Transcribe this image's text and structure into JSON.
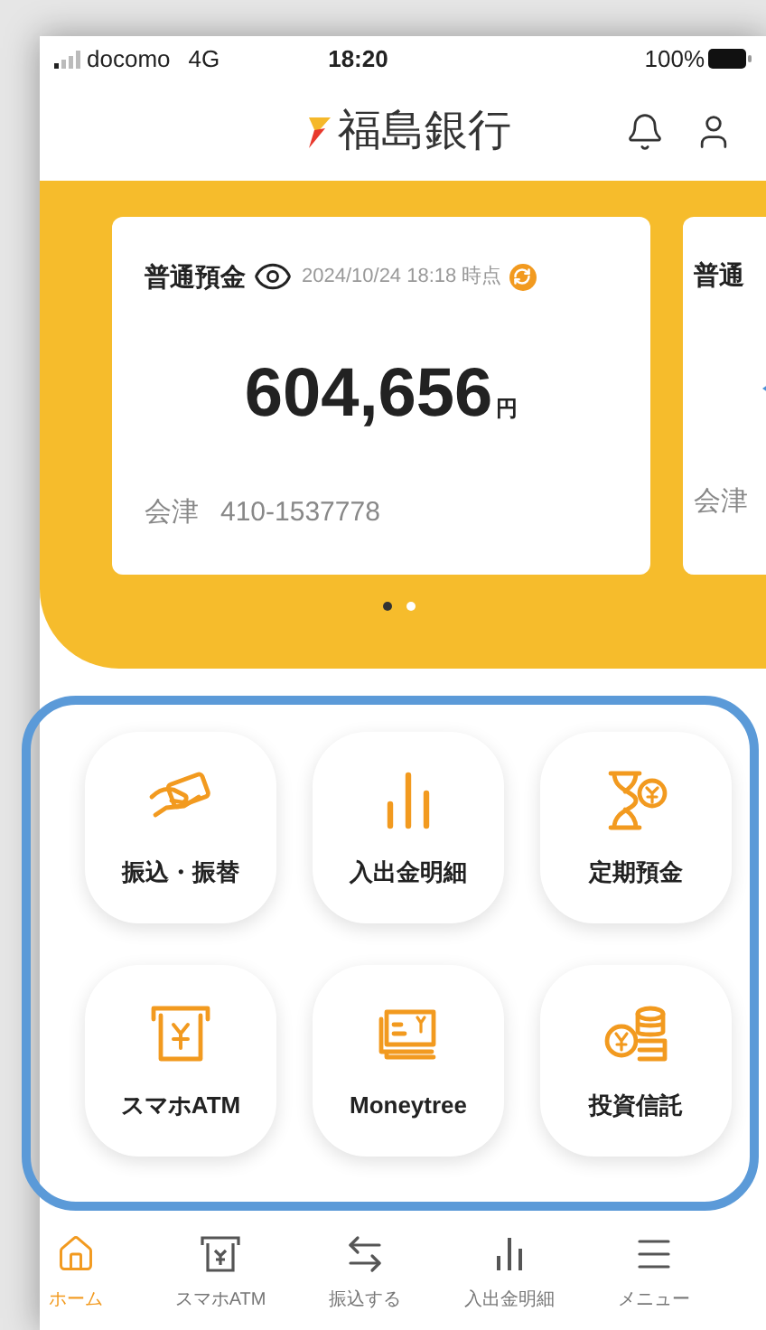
{
  "status_bar": {
    "carrier": "docomo",
    "network": "4G",
    "time": "18:20",
    "battery": "100%"
  },
  "header": {
    "title": "福島銀行"
  },
  "accounts": [
    {
      "type": "普通預金",
      "timestamp": "2024/10/24 18:18 時点",
      "amount": "604,656",
      "unit": "円",
      "branch": "会津",
      "number": "410-1537778"
    },
    {
      "type": "普通",
      "branch": "会津"
    }
  ],
  "carousel_dots": [
    {
      "selected": true
    },
    {
      "selected": false
    }
  ],
  "menu_tiles": [
    {
      "label": "振込・振替"
    },
    {
      "label": "入出金明細"
    },
    {
      "label": "定期預金"
    },
    {
      "label": "スマホATM"
    },
    {
      "label": "Moneytree"
    },
    {
      "label": "投資信託"
    }
  ],
  "bottom_nav": [
    {
      "label": "ホーム",
      "selected": true
    },
    {
      "label": "スマホATM",
      "selected": false
    },
    {
      "label": "振込する",
      "selected": false
    },
    {
      "label": "入出金明細",
      "selected": false
    },
    {
      "label": "メニュー",
      "selected": false
    }
  ]
}
